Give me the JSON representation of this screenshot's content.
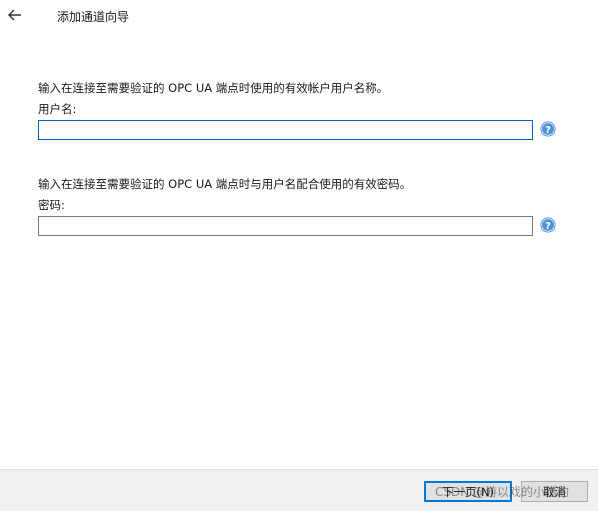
{
  "window": {
    "title": "添加通道向导",
    "back_icon": "arrow-left-icon"
  },
  "username": {
    "description": "输入在连接至需要验证的 OPC UA 端点时使用的有效帐户用户名称。",
    "label": "用户名:",
    "value": "",
    "help_icon": "help-question-icon"
  },
  "password": {
    "description": "输入在连接至需要验证的 OPC UA 端点时与用户名配合使用的有效密码。",
    "label": "密码:",
    "value": "",
    "help_icon": "help-question-icon"
  },
  "footer": {
    "next_label": "下一页(N)",
    "cancel_label": "取消"
  },
  "watermark": {
    "text": "CSDN @游以戏的小猎豹"
  },
  "colors": {
    "accent": "#0078d7",
    "help_icon": "#2b78c8",
    "footer_bg": "#f0f0f0"
  }
}
